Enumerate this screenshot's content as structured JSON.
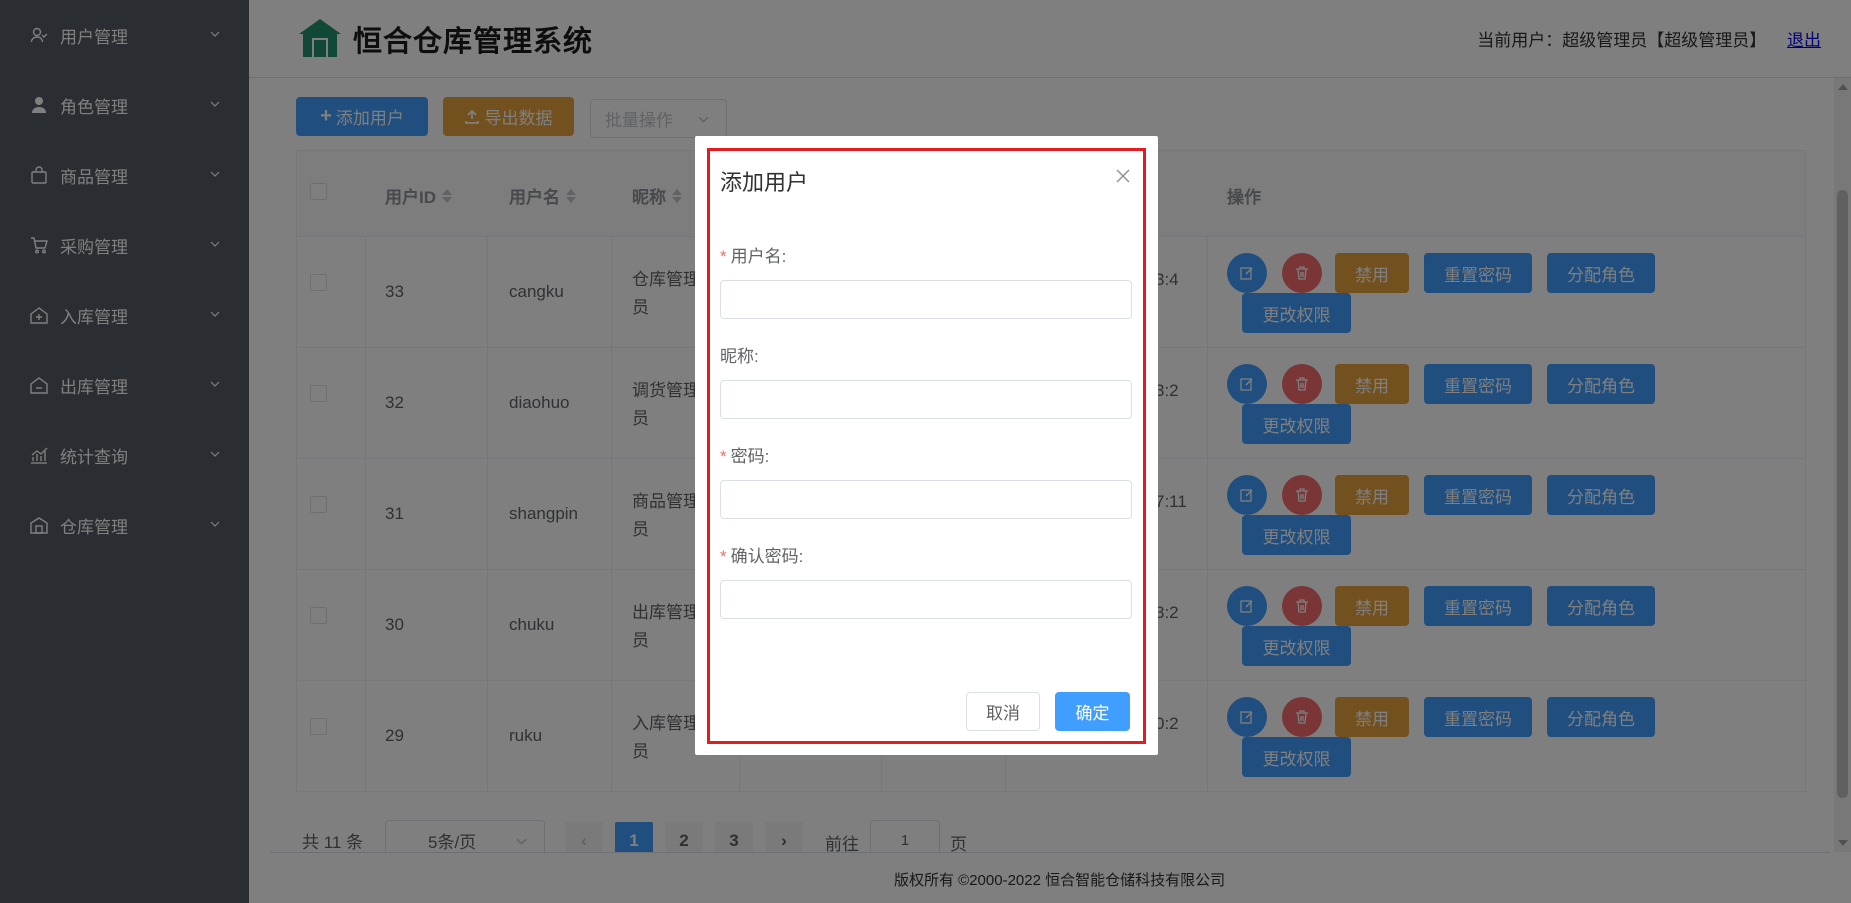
{
  "sidebar": {
    "items": [
      {
        "label": "用户管理",
        "icon": "user-manage-icon"
      },
      {
        "label": "角色管理",
        "icon": "role-icon"
      },
      {
        "label": "商品管理",
        "icon": "bag-icon"
      },
      {
        "label": "采购管理",
        "icon": "cart-icon"
      },
      {
        "label": "入库管理",
        "icon": "inbound-icon"
      },
      {
        "label": "出库管理",
        "icon": "outbound-icon"
      },
      {
        "label": "统计查询",
        "icon": "stats-icon"
      },
      {
        "label": "仓库管理",
        "icon": "warehouse-icon"
      }
    ]
  },
  "header": {
    "title": "恒合仓库管理系统",
    "current_user": "当前用户：超级管理员【超级管理员】",
    "logout": "退出"
  },
  "toolbar": {
    "add_user": "添加用户",
    "export_data": "导出数据",
    "batch_placeholder": "批量操作"
  },
  "table": {
    "headers": {
      "user_id": "用户ID",
      "username": "用户名",
      "nickname": "昵称",
      "actions": "操作"
    },
    "rows": [
      {
        "id": "33",
        "username": "cangku",
        "nickname": "仓库管理员",
        "time": "3:4"
      },
      {
        "id": "32",
        "username": "diaohuo",
        "nickname": "调货管理员",
        "time": "3:2"
      },
      {
        "id": "31",
        "username": "shangpin",
        "nickname": "商品管理员",
        "time": "7:11"
      },
      {
        "id": "30",
        "username": "chuku",
        "nickname": "出库管理员",
        "time": "3:2"
      },
      {
        "id": "29",
        "username": "ruku",
        "nickname": "入库管理员",
        "time": "0:2"
      }
    ],
    "row_actions": {
      "disable": "禁用",
      "reset_password": "重置密码",
      "assign_role": "分配角色",
      "change_permission": "更改权限"
    }
  },
  "pagination": {
    "total": "共 11 条",
    "page_size": "5条/页",
    "pages": [
      "1",
      "2",
      "3"
    ],
    "current_page": 1,
    "goto_label": "前往",
    "goto_value": "1",
    "page_unit": "页",
    "prev_icon": "chevron-left-icon",
    "next_icon": "chevron-right-icon"
  },
  "footer": {
    "copyright": "版权所有 ©2000-2022  恒合智能仓储科技有限公司"
  },
  "modal": {
    "title": "添加用户",
    "fields": {
      "username_label": "用户名:",
      "username_value": "",
      "nickname_label": "昵称:",
      "nickname_value": "",
      "password_label": "密码:",
      "password_value": "",
      "confirm_label": "确认密码:",
      "confirm_value": ""
    },
    "cancel": "取消",
    "confirm": "确定"
  },
  "colors": {
    "sidebar_bg": "#545c64",
    "primary": "#409eff",
    "warning": "#e6a23c",
    "danger": "#f56c6c",
    "highlight_border": "#e11d1d"
  }
}
